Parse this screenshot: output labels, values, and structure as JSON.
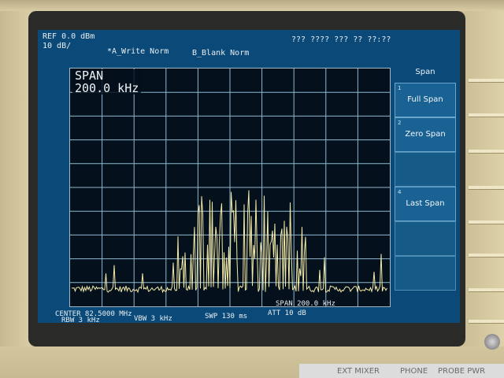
{
  "header": {
    "ref_level": "REF 0.0 dBm",
    "scale": "10 dB/",
    "trace_a": "*A_Write Norm",
    "trace_b": "B_Blank Norm",
    "date_time": "??? ???? ??? ?? ??:??"
  },
  "plot": {
    "span_title": "SPAN",
    "span_value": "200.0 kHz"
  },
  "footer": {
    "center": "CENTER 82.5000 MHz",
    "span": "SPAN 200.0 kHz",
    "rbw": "RBW 3 kHz",
    "vbw": "VBW 3 kHz",
    "swp": "SWP 130 ms",
    "att": "ATT 10 dB"
  },
  "menu": {
    "title": "Span",
    "keys": [
      {
        "num": "1",
        "label": "Full Span"
      },
      {
        "num": "2",
        "label": "Zero Span"
      },
      {
        "num": "4",
        "label": "Last Span"
      }
    ]
  },
  "panel": {
    "ext_mixer": "EXT MIXER",
    "phone": "PHONE",
    "probe_pwr": "PROBE PWR"
  },
  "colors": {
    "screen_bg": "#0b4a78",
    "grid": "#8fb7d0",
    "trace": "#f3e9a8"
  }
}
